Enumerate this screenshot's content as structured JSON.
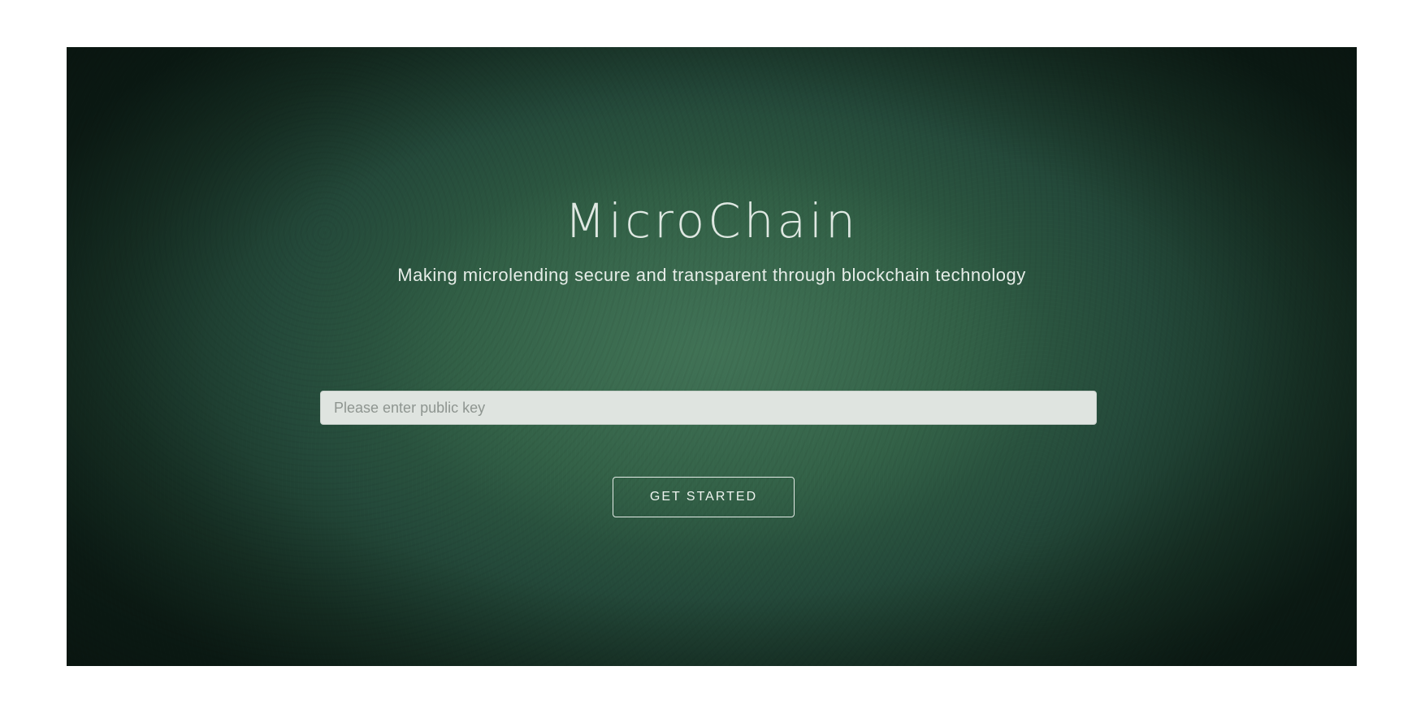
{
  "hero": {
    "title": "MicroChain",
    "subtitle": "Making microlending secure and transparent through blockchain technology"
  },
  "form": {
    "public_key": {
      "value": "",
      "placeholder": "Please enter public key"
    },
    "submit_label": "GET STARTED"
  },
  "colors": {
    "background_center": "#3a6a4f",
    "background_edge": "#0e2119",
    "text": "#dfe8e2",
    "input_background": "#dfe4e0",
    "button_border": "#e3ebe6"
  }
}
